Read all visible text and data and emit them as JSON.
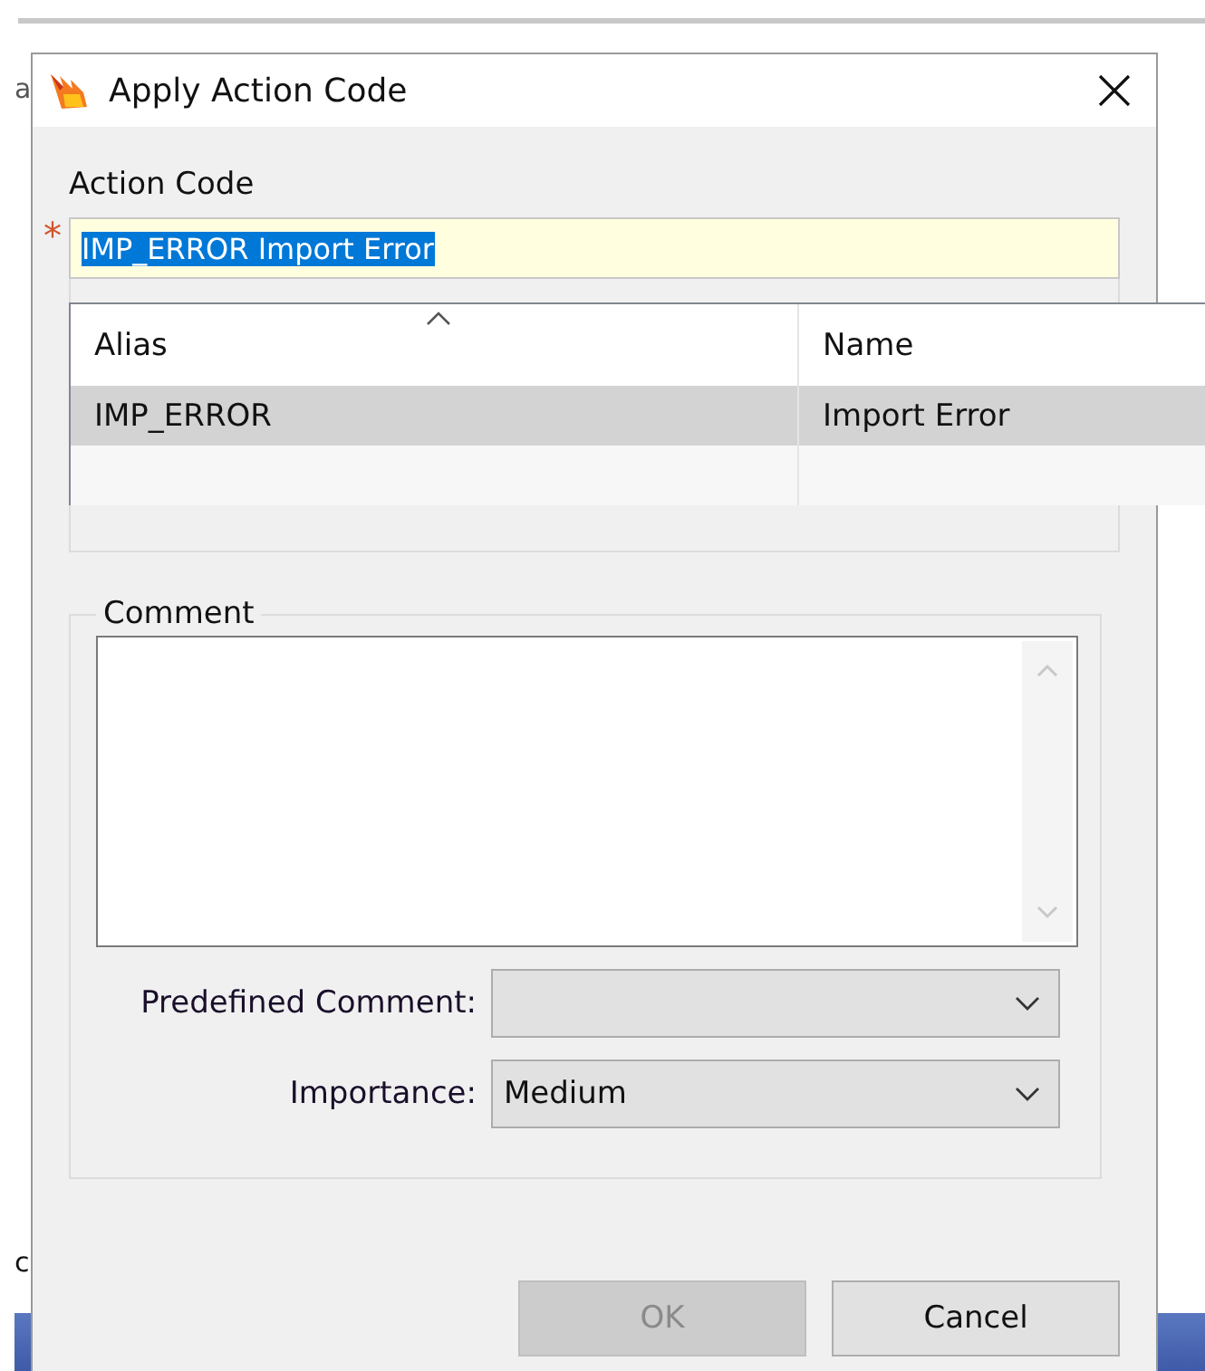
{
  "background": {
    "fragments": [
      "a",
      "c"
    ]
  },
  "window": {
    "title": "Apply Action Code"
  },
  "action_code": {
    "label": "Action Code",
    "required_mark": "*",
    "value": "IMP_ERROR Import Error",
    "text_selected": true
  },
  "lookup": {
    "columns": [
      "Alias",
      "Name"
    ],
    "rows": [
      {
        "cells": [
          "IMP_ERROR",
          "Import Error"
        ],
        "selected": true
      },
      {
        "cells": [
          "",
          ""
        ],
        "selected": false
      }
    ]
  },
  "comment": {
    "legend": "Comment"
  },
  "predefined_comment": {
    "label": "Predefined Comment:"
  },
  "importance": {
    "label": "Importance:",
    "value": "Medium"
  },
  "buttons": [
    {
      "label": "OK",
      "disabled": true
    },
    {
      "label": "Cancel",
      "disabled": false
    }
  ]
}
